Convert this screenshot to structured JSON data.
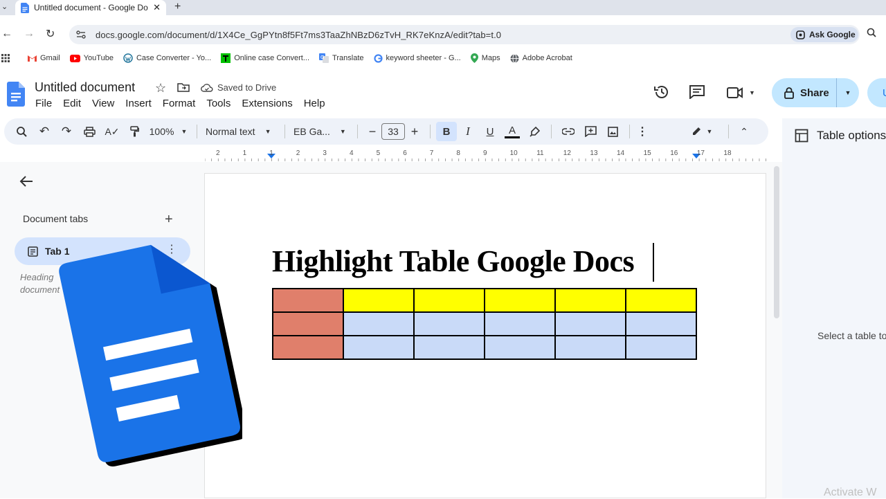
{
  "browser": {
    "tab_title": "Untitled document - Google Docs",
    "url": "docs.google.com/document/d/1X4Ce_GgPYtn8f5Ft7ms3TaaZhNBzD6zTvH_RK7eKnzA/edit?tab=t.0",
    "ask_google": "Ask Google",
    "bookmarks": [
      {
        "label": "Gmail",
        "icon": "gmail-icon"
      },
      {
        "label": "YouTube",
        "icon": "youtube-icon"
      },
      {
        "label": "Case Converter - Yo...",
        "icon": "wordpress-icon"
      },
      {
        "label": "Online case Convert...",
        "icon": "text-t-icon"
      },
      {
        "label": "Translate",
        "icon": "translate-icon"
      },
      {
        "label": "keyword sheeter - G...",
        "icon": "google-icon"
      },
      {
        "label": "Maps",
        "icon": "maps-pin-icon"
      },
      {
        "label": "Adobe Acrobat",
        "icon": "globe-icon"
      }
    ]
  },
  "docs": {
    "title": "Untitled document",
    "saved_status": "Saved to Drive",
    "menu": [
      "File",
      "Edit",
      "View",
      "Insert",
      "Format",
      "Tools",
      "Extensions",
      "Help"
    ],
    "share_label": "Share",
    "avatar_letter": "U"
  },
  "toolbar": {
    "zoom": "100%",
    "style": "Normal text",
    "font": "EB Ga...",
    "font_size": "33",
    "bold": "B",
    "italic": "I",
    "underline": "U",
    "text_color": "A"
  },
  "ruler": {
    "labels": [
      "2",
      "1",
      "1",
      "2",
      "3",
      "4",
      "5",
      "6",
      "7",
      "8",
      "9",
      "10",
      "11",
      "12",
      "13",
      "14",
      "15",
      "16",
      "17",
      "18"
    ]
  },
  "left_panel": {
    "section_label": "Document tabs",
    "add_symbol": "+",
    "tab_label": "Tab 1",
    "hint_line1": "Heading",
    "hint_line2": "document"
  },
  "document": {
    "heading": "Highlight Table Google Docs",
    "table": {
      "rows": 3,
      "cols": 6,
      "colors": {
        "first_col": "#e07f6b",
        "header_row": "#ffff00",
        "body": "#c9daf8"
      }
    }
  },
  "right_panel": {
    "title": "Table options",
    "hint": "Select a table to",
    "watermark": "Activate W"
  },
  "colors": {
    "accent_blue": "#1a73e8",
    "share_bg": "#c2e7ff",
    "toolbar_bg": "#eef2f9"
  }
}
